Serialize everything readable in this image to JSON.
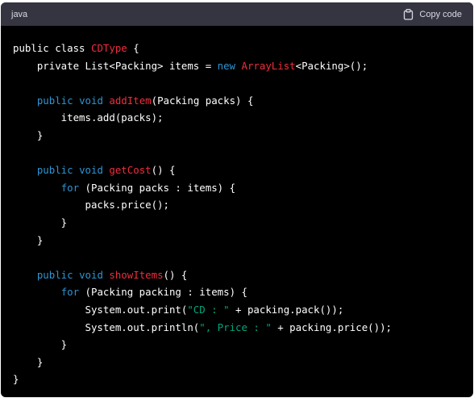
{
  "header": {
    "language": "java",
    "copy_label": "Copy code",
    "copy_icon": "clipboard-icon"
  },
  "colors": {
    "background": "#000000",
    "header_background": "#343541",
    "plain": "#ffffff",
    "keyword": "#2e95d3",
    "function": "#f22c3d",
    "string": "#00a67d"
  },
  "code": [
    [
      [
        "plain",
        "public class "
      ],
      [
        "fn",
        "CDType"
      ],
      [
        "plain",
        " {"
      ]
    ],
    [
      [
        "plain",
        "    private List<Packing> items = "
      ],
      [
        "kw",
        "new"
      ],
      [
        "plain",
        " "
      ],
      [
        "fn",
        "ArrayList"
      ],
      [
        "plain",
        "<Packing>();"
      ]
    ],
    [],
    [
      [
        "plain",
        "    "
      ],
      [
        "kw",
        "public"
      ],
      [
        "plain",
        " "
      ],
      [
        "kw",
        "void"
      ],
      [
        "plain",
        " "
      ],
      [
        "fn",
        "addItem"
      ],
      [
        "plain",
        "(Packing packs) {"
      ]
    ],
    [
      [
        "plain",
        "        items.add(packs);"
      ]
    ],
    [
      [
        "plain",
        "    }"
      ]
    ],
    [],
    [
      [
        "plain",
        "    "
      ],
      [
        "kw",
        "public"
      ],
      [
        "plain",
        " "
      ],
      [
        "kw",
        "void"
      ],
      [
        "plain",
        " "
      ],
      [
        "fn",
        "getCost"
      ],
      [
        "plain",
        "() {"
      ]
    ],
    [
      [
        "plain",
        "        "
      ],
      [
        "kw",
        "for"
      ],
      [
        "plain",
        " (Packing packs : items) {"
      ]
    ],
    [
      [
        "plain",
        "            packs.price();"
      ]
    ],
    [
      [
        "plain",
        "        }"
      ]
    ],
    [
      [
        "plain",
        "    }"
      ]
    ],
    [],
    [
      [
        "plain",
        "    "
      ],
      [
        "kw",
        "public"
      ],
      [
        "plain",
        " "
      ],
      [
        "kw",
        "void"
      ],
      [
        "plain",
        " "
      ],
      [
        "fn",
        "showItems"
      ],
      [
        "plain",
        "() {"
      ]
    ],
    [
      [
        "plain",
        "        "
      ],
      [
        "kw",
        "for"
      ],
      [
        "plain",
        " (Packing packing : items) {"
      ]
    ],
    [
      [
        "plain",
        "            System.out.print("
      ],
      [
        "str",
        "\"CD : \""
      ],
      [
        "plain",
        " + packing.pack());"
      ]
    ],
    [
      [
        "plain",
        "            System.out.println("
      ],
      [
        "str",
        "\", Price : \""
      ],
      [
        "plain",
        " + packing.price());"
      ]
    ],
    [
      [
        "plain",
        "        }"
      ]
    ],
    [
      [
        "plain",
        "    }"
      ]
    ],
    [
      [
        "plain",
        "}"
      ]
    ]
  ]
}
